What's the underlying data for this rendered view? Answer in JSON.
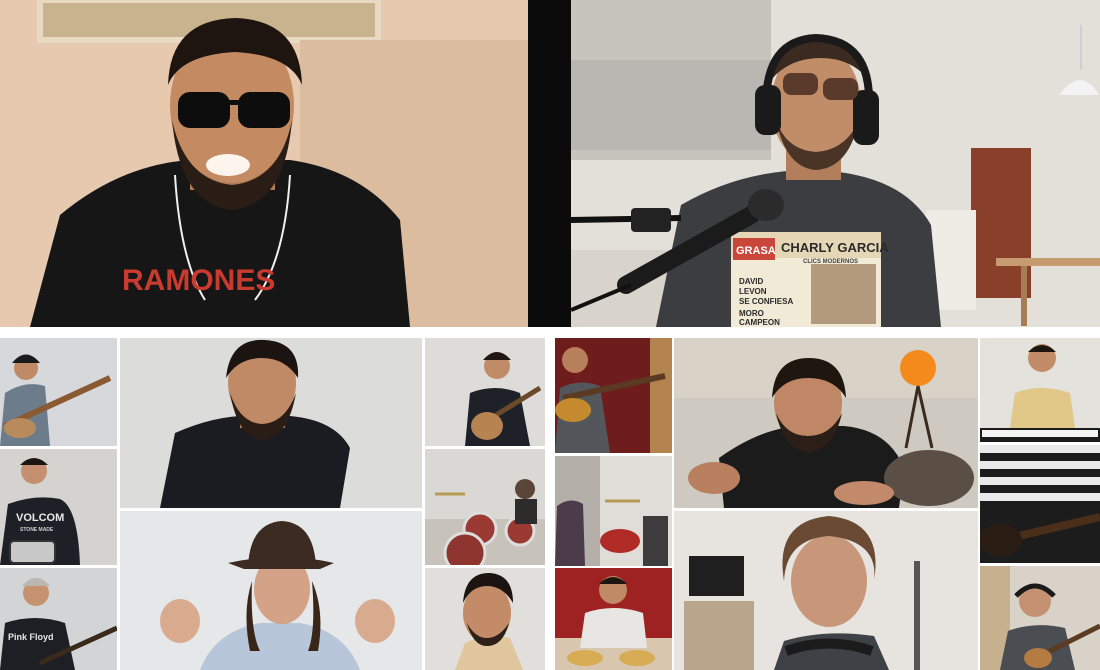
{
  "collage": {
    "top_left": {
      "shirt_text": "RAMONES"
    },
    "top_right": {
      "shirt_title": "CHARLY GARCIA",
      "shirt_subtitle": "CLICS MODERNOS",
      "shirt_badge": "GRASA",
      "shirt_line_1": "DAVID",
      "shirt_line_2": "LEVON",
      "shirt_line_3": "SE CONFIESA",
      "shirt_line_4": "MORO",
      "shirt_line_5": "CAMPEON"
    },
    "bottom_left": {
      "drummer_shirt_text": "VOLCOM",
      "drummer_shirt_sub": "STONE MADE",
      "guitarist_shirt_text": "Pink Floyd"
    }
  }
}
